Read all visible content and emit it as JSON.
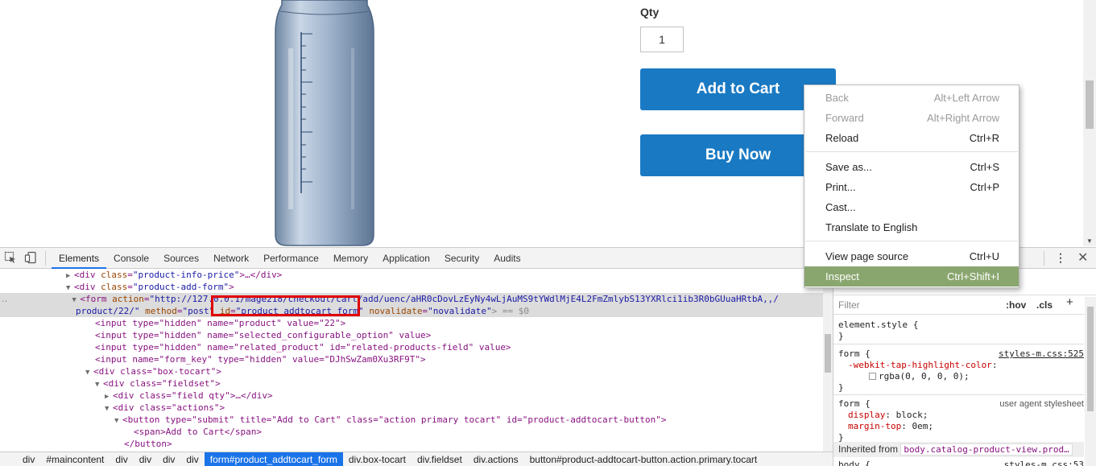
{
  "product": {
    "qty_label": "Qty",
    "qty_value": "1",
    "add_to_cart_label": "Add to Cart",
    "buy_now_label": "Buy Now",
    "accent": "#1979c3"
  },
  "devtools": {
    "tabs": [
      "Elements",
      "Console",
      "Sources",
      "Network",
      "Performance",
      "Memory",
      "Application",
      "Security",
      "Audits"
    ],
    "active_tab": "Elements",
    "dom": {
      "l1_tag": "<div ",
      "l1_attr": "class",
      "l1_val": "\"product-info-price\"",
      "l1_rest": ">…</div>",
      "l2_tag": "<div ",
      "l2_attr": "class",
      "l2_val": "\"product-add-form\"",
      "l2_rest": ">",
      "l3_tag": "<form ",
      "l3_attr1": "action",
      "l3_val1": "\"http://127.0.0.1/mage218/checkout/cart/add/uenc/aHR0cDovLzEyNy4wLjAuMS9tYWdlMjE4L2FmZmlybS13YXRlci1ib3R0bGUuaHRtbA,,/",
      "l3b_val1": "product/22/\"",
      "l3b_attr2": "method",
      "l3b_val2": "\"post\"",
      "l3b_attr3": "id",
      "l3b_val3": "\"product_addtocart_form\"",
      "l3b_attr4": "novalidate",
      "l3b_val4": "\"novalidate\"",
      "l3b_tail": "> == $0",
      "l4": "<input type=\"hidden\" name=\"product\" value=\"22\">",
      "l5": "<input type=\"hidden\" name=\"selected_configurable_option\" value>",
      "l6": "<input type=\"hidden\" name=\"related_product\" id=\"related-products-field\" value>",
      "l7": "<input name=\"form_key\" type=\"hidden\" value=\"DJhSwZam0Xu3RF9T\">",
      "l8": "<div class=\"box-tocart\">",
      "l9": "<div class=\"fieldset\">",
      "l10": "<div class=\"field qty\">…</div>",
      "l11": "<div class=\"actions\">",
      "l12": "<button type=\"submit\" title=\"Add to Cart\" class=\"action primary tocart\" id=\"product-addtocart-button\">",
      "l13": "<span>Add to Cart</span>",
      "l14": "</button>"
    },
    "styles": {
      "filter_placeholder": "Filter",
      "hov": ":hov",
      "cls": ".cls",
      "element_style": "element.style {",
      "close_brace": "}",
      "rule1_selector": "form {",
      "rule1_source": "styles-m.css:525",
      "rule1_prop": "-webkit-tap-highlight-color",
      "rule1_val": "rgba(0, 0, 0, 0);",
      "rule2_selector": "form {",
      "rule2_source": "user agent stylesheet",
      "rule2_prop1": "display",
      "rule2_val1": "block;",
      "rule2_prop2": "margin-top",
      "rule2_val2": "0em;",
      "inherited_label": "Inherited from",
      "inherited_link": "body.catalog-product-view.prod…",
      "rule3_selector": "body {",
      "rule3_source": "styles-m.css:53"
    },
    "breadcrumbs": [
      "div",
      "#maincontent",
      "div",
      "div",
      "div",
      "div",
      "form#product_addtocart_form",
      "div.box-tocart",
      "div.fieldset",
      "div.actions",
      "button#product-addtocart-button.action.primary.tocart"
    ],
    "active_crumb": "form#product_addtocart_form"
  },
  "context_menu": {
    "items": [
      {
        "label": "Back",
        "shortcut": "Alt+Left Arrow",
        "disabled": true
      },
      {
        "label": "Forward",
        "shortcut": "Alt+Right Arrow",
        "disabled": true
      },
      {
        "label": "Reload",
        "shortcut": "Ctrl+R"
      },
      {
        "label": "Save as...",
        "shortcut": "Ctrl+S"
      },
      {
        "label": "Print...",
        "shortcut": "Ctrl+P"
      },
      {
        "label": "Cast...",
        "shortcut": ""
      },
      {
        "label": "Translate to English",
        "shortcut": ""
      },
      {
        "label": "View page source",
        "shortcut": "Ctrl+U"
      },
      {
        "label": "Inspect",
        "shortcut": "Ctrl+Shift+I",
        "highlighted": true
      }
    ],
    "highlight_color": "#8aa66f"
  }
}
